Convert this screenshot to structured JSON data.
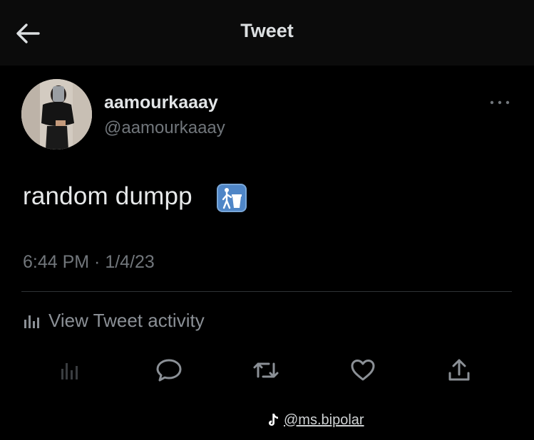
{
  "header": {
    "title": "Tweet",
    "back_icon": "arrow-left-icon"
  },
  "author": {
    "display_name": "aamourkaaay",
    "handle": "@aamourkaaay"
  },
  "tweet": {
    "text": "random dumpp",
    "emoji": "wastebasket-icon",
    "timestamp": "6:44 PM · 1/4/23"
  },
  "activity": {
    "label": "View Tweet activity",
    "icon": "bar-chart-icon"
  },
  "actions": [
    {
      "name": "analytics",
      "icon": "bar-chart-icon"
    },
    {
      "name": "reply",
      "icon": "comment-icon"
    },
    {
      "name": "retweet",
      "icon": "retweet-icon"
    },
    {
      "name": "like",
      "icon": "heart-icon"
    },
    {
      "name": "share",
      "icon": "share-icon"
    }
  ],
  "watermark": {
    "text": "@ms.bipolar",
    "icon": "tiktok-icon"
  },
  "colors": {
    "background": "#000000",
    "header_background": "#0b0b0b",
    "primary_text": "#e7e9ea",
    "secondary_text": "#71767b",
    "divider": "#2f3336"
  }
}
